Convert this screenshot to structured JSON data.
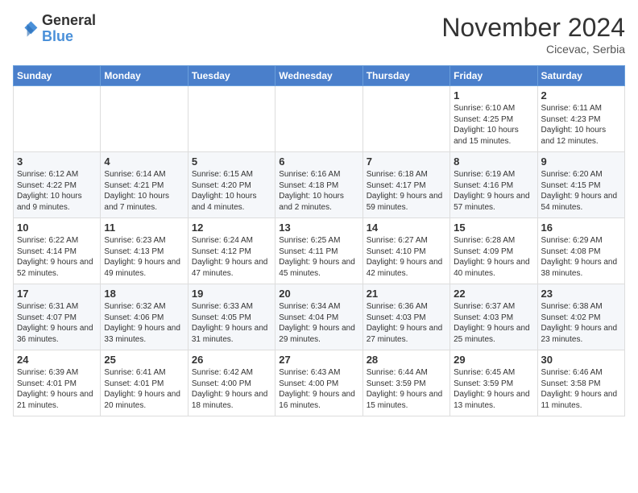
{
  "header": {
    "logo": {
      "line1": "General",
      "line2": "Blue"
    },
    "title": "November 2024",
    "subtitle": "Cicevac, Serbia"
  },
  "weekdays": [
    "Sunday",
    "Monday",
    "Tuesday",
    "Wednesday",
    "Thursday",
    "Friday",
    "Saturday"
  ],
  "weeks": [
    [
      {
        "day": "",
        "info": ""
      },
      {
        "day": "",
        "info": ""
      },
      {
        "day": "",
        "info": ""
      },
      {
        "day": "",
        "info": ""
      },
      {
        "day": "",
        "info": ""
      },
      {
        "day": "1",
        "info": "Sunrise: 6:10 AM\nSunset: 4:25 PM\nDaylight: 10 hours and 15 minutes."
      },
      {
        "day": "2",
        "info": "Sunrise: 6:11 AM\nSunset: 4:23 PM\nDaylight: 10 hours and 12 minutes."
      }
    ],
    [
      {
        "day": "3",
        "info": "Sunrise: 6:12 AM\nSunset: 4:22 PM\nDaylight: 10 hours and 9 minutes."
      },
      {
        "day": "4",
        "info": "Sunrise: 6:14 AM\nSunset: 4:21 PM\nDaylight: 10 hours and 7 minutes."
      },
      {
        "day": "5",
        "info": "Sunrise: 6:15 AM\nSunset: 4:20 PM\nDaylight: 10 hours and 4 minutes."
      },
      {
        "day": "6",
        "info": "Sunrise: 6:16 AM\nSunset: 4:18 PM\nDaylight: 10 hours and 2 minutes."
      },
      {
        "day": "7",
        "info": "Sunrise: 6:18 AM\nSunset: 4:17 PM\nDaylight: 9 hours and 59 minutes."
      },
      {
        "day": "8",
        "info": "Sunrise: 6:19 AM\nSunset: 4:16 PM\nDaylight: 9 hours and 57 minutes."
      },
      {
        "day": "9",
        "info": "Sunrise: 6:20 AM\nSunset: 4:15 PM\nDaylight: 9 hours and 54 minutes."
      }
    ],
    [
      {
        "day": "10",
        "info": "Sunrise: 6:22 AM\nSunset: 4:14 PM\nDaylight: 9 hours and 52 minutes."
      },
      {
        "day": "11",
        "info": "Sunrise: 6:23 AM\nSunset: 4:13 PM\nDaylight: 9 hours and 49 minutes."
      },
      {
        "day": "12",
        "info": "Sunrise: 6:24 AM\nSunset: 4:12 PM\nDaylight: 9 hours and 47 minutes."
      },
      {
        "day": "13",
        "info": "Sunrise: 6:25 AM\nSunset: 4:11 PM\nDaylight: 9 hours and 45 minutes."
      },
      {
        "day": "14",
        "info": "Sunrise: 6:27 AM\nSunset: 4:10 PM\nDaylight: 9 hours and 42 minutes."
      },
      {
        "day": "15",
        "info": "Sunrise: 6:28 AM\nSunset: 4:09 PM\nDaylight: 9 hours and 40 minutes."
      },
      {
        "day": "16",
        "info": "Sunrise: 6:29 AM\nSunset: 4:08 PM\nDaylight: 9 hours and 38 minutes."
      }
    ],
    [
      {
        "day": "17",
        "info": "Sunrise: 6:31 AM\nSunset: 4:07 PM\nDaylight: 9 hours and 36 minutes."
      },
      {
        "day": "18",
        "info": "Sunrise: 6:32 AM\nSunset: 4:06 PM\nDaylight: 9 hours and 33 minutes."
      },
      {
        "day": "19",
        "info": "Sunrise: 6:33 AM\nSunset: 4:05 PM\nDaylight: 9 hours and 31 minutes."
      },
      {
        "day": "20",
        "info": "Sunrise: 6:34 AM\nSunset: 4:04 PM\nDaylight: 9 hours and 29 minutes."
      },
      {
        "day": "21",
        "info": "Sunrise: 6:36 AM\nSunset: 4:03 PM\nDaylight: 9 hours and 27 minutes."
      },
      {
        "day": "22",
        "info": "Sunrise: 6:37 AM\nSunset: 4:03 PM\nDaylight: 9 hours and 25 minutes."
      },
      {
        "day": "23",
        "info": "Sunrise: 6:38 AM\nSunset: 4:02 PM\nDaylight: 9 hours and 23 minutes."
      }
    ],
    [
      {
        "day": "24",
        "info": "Sunrise: 6:39 AM\nSunset: 4:01 PM\nDaylight: 9 hours and 21 minutes."
      },
      {
        "day": "25",
        "info": "Sunrise: 6:41 AM\nSunset: 4:01 PM\nDaylight: 9 hours and 20 minutes."
      },
      {
        "day": "26",
        "info": "Sunrise: 6:42 AM\nSunset: 4:00 PM\nDaylight: 9 hours and 18 minutes."
      },
      {
        "day": "27",
        "info": "Sunrise: 6:43 AM\nSunset: 4:00 PM\nDaylight: 9 hours and 16 minutes."
      },
      {
        "day": "28",
        "info": "Sunrise: 6:44 AM\nSunset: 3:59 PM\nDaylight: 9 hours and 15 minutes."
      },
      {
        "day": "29",
        "info": "Sunrise: 6:45 AM\nSunset: 3:59 PM\nDaylight: 9 hours and 13 minutes."
      },
      {
        "day": "30",
        "info": "Sunrise: 6:46 AM\nSunset: 3:58 PM\nDaylight: 9 hours and 11 minutes."
      }
    ]
  ]
}
